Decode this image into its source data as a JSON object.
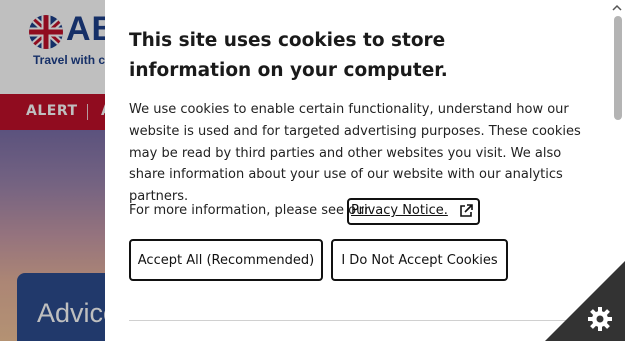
{
  "site": {
    "logo_text": "AB",
    "tagline": "Travel with c",
    "nav": {
      "alert": "ALERT",
      "next_item": "A"
    },
    "hero_card_text": "Advice"
  },
  "cookie_dialog": {
    "title": "This site uses cookies to store information on your computer.",
    "body": "We use cookies to enable certain functionality, understand how our website is used and for targeted advertising purposes. These cookies may be read by third parties and other websites you visit. We also share information about your use of our website with our analytics partners.",
    "more_info_prefix": "For more information, please see our",
    "privacy_link": "Privacy Notice.",
    "accept_all": "Accept All (Recommended)",
    "decline": "I Do Not Accept Cookies"
  },
  "icons": {
    "external_link": "external-link-icon",
    "cookie_settings": "gear-icon",
    "scroll_up": "chevron-up-icon"
  },
  "colors": {
    "brand_blue": "#1d3f8a",
    "nav_red": "#c0102a",
    "corner_dark": "#333333"
  }
}
